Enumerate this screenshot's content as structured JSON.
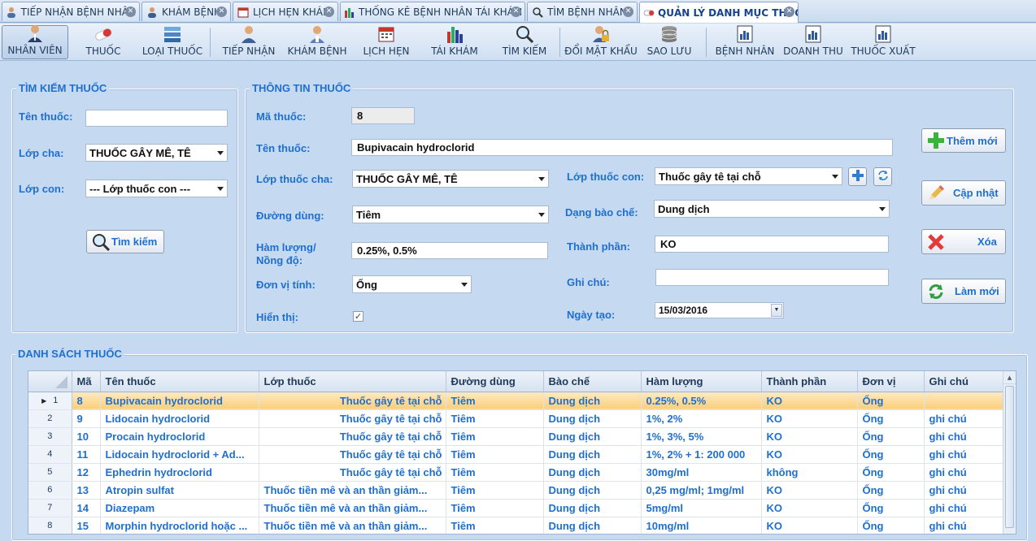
{
  "tabs": [
    {
      "label": "TIẾP NHẬN BỆNH NHÂN",
      "icon": "person-icon"
    },
    {
      "label": "KHÁM BỆNH",
      "icon": "doctor-icon"
    },
    {
      "label": "LỊCH HẸN KHÁM",
      "icon": "calendar-icon"
    },
    {
      "label": "THỐNG KÊ BỆNH NHÂN TÁI KHÁM",
      "icon": "bar-chart-icon"
    },
    {
      "label": "TÌM BỆNH NHÂN",
      "icon": "search-icon"
    },
    {
      "label": "QUẢN LÝ DANH MỤC THUỐC",
      "icon": "pill-icon"
    }
  ],
  "toolbar": [
    {
      "label": "NHÂN VIÊN",
      "icon": "staff-icon"
    },
    {
      "label": "THUỐC",
      "icon": "pill-icon"
    },
    {
      "label": "LOẠI THUỐC",
      "icon": "category-icon"
    },
    {
      "label": "TIẾP NHẬN",
      "icon": "person-icon"
    },
    {
      "label": "KHÁM BỆNH",
      "icon": "doctor-icon"
    },
    {
      "label": "LỊCH HẸN",
      "icon": "calendar-icon"
    },
    {
      "label": "TÁI KHÁM",
      "icon": "bar-chart-icon"
    },
    {
      "label": "TÌM KIẾM",
      "icon": "search-icon"
    },
    {
      "label": "ĐỔI MẬT KHẨU",
      "icon": "lock-user-icon"
    },
    {
      "label": "SAO LƯU",
      "icon": "database-icon"
    },
    {
      "label": "BỆNH NHÂN",
      "icon": "report-icon"
    },
    {
      "label": "DOANH THU",
      "icon": "report-icon"
    },
    {
      "label": "THUỐC XUẤT",
      "icon": "report-icon"
    }
  ],
  "search": {
    "title": "TÌM KIẾM THUỐC",
    "name_label": "Tên thuốc:",
    "name_value": "",
    "parent_label": "Lớp cha:",
    "parent_value": "THUỐC GÂY MÊ, TÊ",
    "child_label": "Lớp con:",
    "child_value": "--- Lớp thuốc con ---",
    "button": "Tìm kiếm"
  },
  "info": {
    "title": "THÔNG TIN THUỐC",
    "code_label": "Mã thuốc:",
    "code_value": "8",
    "name_label": "Tên thuốc:",
    "name_value": "Bupivacain hydroclorid",
    "parent_label": "Lớp thuốc cha:",
    "parent_value": "THUỐC GÂY MÊ, TÊ",
    "child_label": "Lớp thuốc con:",
    "child_value": "Thuốc gây tê tại chỗ",
    "route_label": "Đường dùng:",
    "route_value": "Tiêm",
    "form_label": "Dạng bào chế:",
    "form_value": "Dung dịch",
    "conc_label_1": "Hàm lượng/",
    "conc_label_2": "Nồng độ:",
    "conc_value": "0.25%, 0.5%",
    "ingredient_label": "Thành phần:",
    "ingredient_value": "KO",
    "unit_label": "Đơn vị tính:",
    "unit_value": "Ống",
    "note_label": "Ghi chú:",
    "note_value": "",
    "visible_label": "Hiển thị:",
    "visible_checked": true,
    "date_label": "Ngày tạo:",
    "date_value": "15/03/2016"
  },
  "actions": {
    "add": "Thêm mới",
    "update": "Cập nhật",
    "delete": "Xóa",
    "refresh": "Làm mới"
  },
  "list": {
    "title": "DANH SÁCH THUỐC",
    "columns": [
      "Mã",
      "Tên thuốc",
      "Lớp thuốc",
      "Đường dùng",
      "Bào chế",
      "Hàm lượng",
      "Thành phần",
      "Đơn vị",
      "Ghi chú"
    ],
    "rows": [
      {
        "n": "1",
        "ma": "8",
        "ten": "Bupivacain hydroclorid",
        "lop": "Thuốc gây tê tại chỗ",
        "duong": "Tiêm",
        "bao": "Dung dịch",
        "ham": "0.25%, 0.5%",
        "thanh": "KO",
        "don": "Ống",
        "ghi": ""
      },
      {
        "n": "2",
        "ma": "9",
        "ten": "Lidocain hydroclorid",
        "lop": "Thuốc gây tê tại chỗ",
        "duong": "Tiêm",
        "bao": "Dung dịch",
        "ham": "1%, 2%",
        "thanh": "KO",
        "don": "Ống",
        "ghi": "ghi chú"
      },
      {
        "n": "3",
        "ma": "10",
        "ten": "Procain hydroclorid",
        "lop": "Thuốc gây tê tại chỗ",
        "duong": "Tiêm",
        "bao": "Dung dịch",
        "ham": "1%, 3%, 5%",
        "thanh": "KO",
        "don": "Ống",
        "ghi": "ghi chú"
      },
      {
        "n": "4",
        "ma": "11",
        "ten": "Lidocain hydroclorid + Ad...",
        "lop": "Thuốc gây tê tại chỗ",
        "duong": "Tiêm",
        "bao": "Dung dịch",
        "ham": "1%, 2% + 1: 200 000",
        "thanh": "KO",
        "don": "Ống",
        "ghi": "ghi chú"
      },
      {
        "n": "5",
        "ma": "12",
        "ten": "Ephedrin hydroclorid",
        "lop": "Thuốc gây tê tại chỗ",
        "duong": "Tiêm",
        "bao": "Dung dịch",
        "ham": "30mg/ml",
        "thanh": "không",
        "don": "Ống",
        "ghi": "ghi chú"
      },
      {
        "n": "6",
        "ma": "13",
        "ten": "Atropin sulfat",
        "lop": "Thuốc tiền mê và an thần giảm...",
        "duong": "Tiêm",
        "bao": "Dung dịch",
        "ham": "0,25 mg/ml; 1mg/ml",
        "thanh": "KO",
        "don": "Ống",
        "ghi": "ghi chú"
      },
      {
        "n": "7",
        "ma": "14",
        "ten": "Diazepam",
        "lop": "Thuốc tiền mê và an thần giảm...",
        "duong": "Tiêm",
        "bao": "Dung dịch",
        "ham": "5mg/ml",
        "thanh": "KO",
        "don": "Ống",
        "ghi": "ghi chú"
      },
      {
        "n": "8",
        "ma": "15",
        "ten": "Morphin hydroclorid hoặc ...",
        "lop": "Thuốc tiền mê và an thần giảm...",
        "duong": "Tiêm",
        "bao": "Dung dịch",
        "ham": "10mg/ml",
        "thanh": "KO",
        "don": "Ống",
        "ghi": "ghi chú"
      }
    ]
  }
}
